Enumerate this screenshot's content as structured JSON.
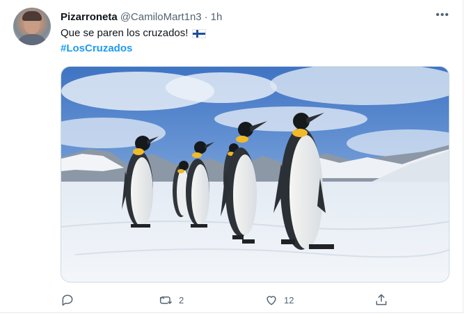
{
  "tweet": {
    "display_name": "Pizarroneta",
    "handle": "@CamiloMart1n3",
    "separator": "·",
    "time": "1h",
    "text": "Que se paren los cruzados!",
    "flag_icon": "finland-flag-icon",
    "hashtag": "#LosCruzados",
    "more_label": "•••"
  },
  "actions": {
    "reply_icon": "reply-icon",
    "retweet_icon": "retweet-icon",
    "retweet_count": "2",
    "like_icon": "heart-icon",
    "like_count": "12",
    "share_icon": "share-icon"
  },
  "colors": {
    "link": "#1d9bf0",
    "secondary": "#536471",
    "text": "#0f1419"
  }
}
